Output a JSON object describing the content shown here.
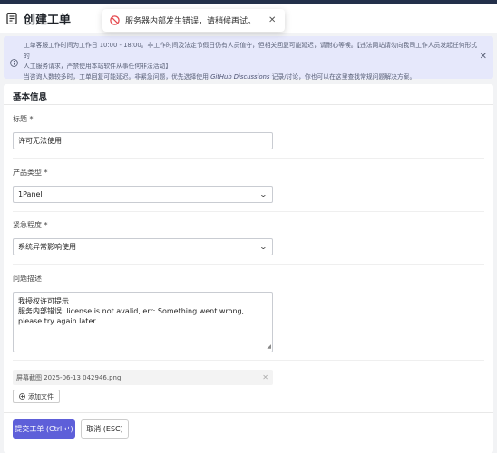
{
  "header": {
    "title": "创建工单"
  },
  "toast": {
    "message": "服务器内部发生错误，请稍候再试。",
    "close": "✕"
  },
  "notice": {
    "line1": "工单客服工作时间为工作日 10:00 - 18:00。非工作时间及法定节假日仍有人员值守，但相关回复可能延迟，请耐心等候。【违法网站请勿向我司工作人员发起任何形式的",
    "line2": "人工服务请求，严禁使用本站软件从事任何非法活动】",
    "line3_pre": "当咨询人数较多时，工单回复可能延迟。非紧急问题，优先选择使用 ",
    "line3_link": "GitHub Discussions",
    "line3_post": " 记录/讨论，你也可以在这里查找常规问题解决方案。",
    "close": "✕"
  },
  "form": {
    "section_title": "基本信息",
    "title_label": "标题 *",
    "title_value": "许可无法使用",
    "product_label": "产品类型 *",
    "product_value": "1Panel",
    "urgency_label": "紧急程度 *",
    "urgency_value": "系统异常影响使用",
    "desc_label": "问题描述",
    "desc_line1": "我授权许可提示",
    "desc_line2": "服务内部错误: license is not avalid, err: Something went wrong, please try again later.",
    "attachment_name": "屏幕截图 2025-06-13 042946.png",
    "attachment_remove": "✕",
    "add_file_label": "添加文件"
  },
  "actions": {
    "submit_label": "提交工单 (Ctrl ↵)",
    "cancel_label": "取消 (ESC)"
  },
  "colors": {
    "accent": "#5e5fd9",
    "notice_bg": "#e6e8fb",
    "error": "#e5484d"
  }
}
